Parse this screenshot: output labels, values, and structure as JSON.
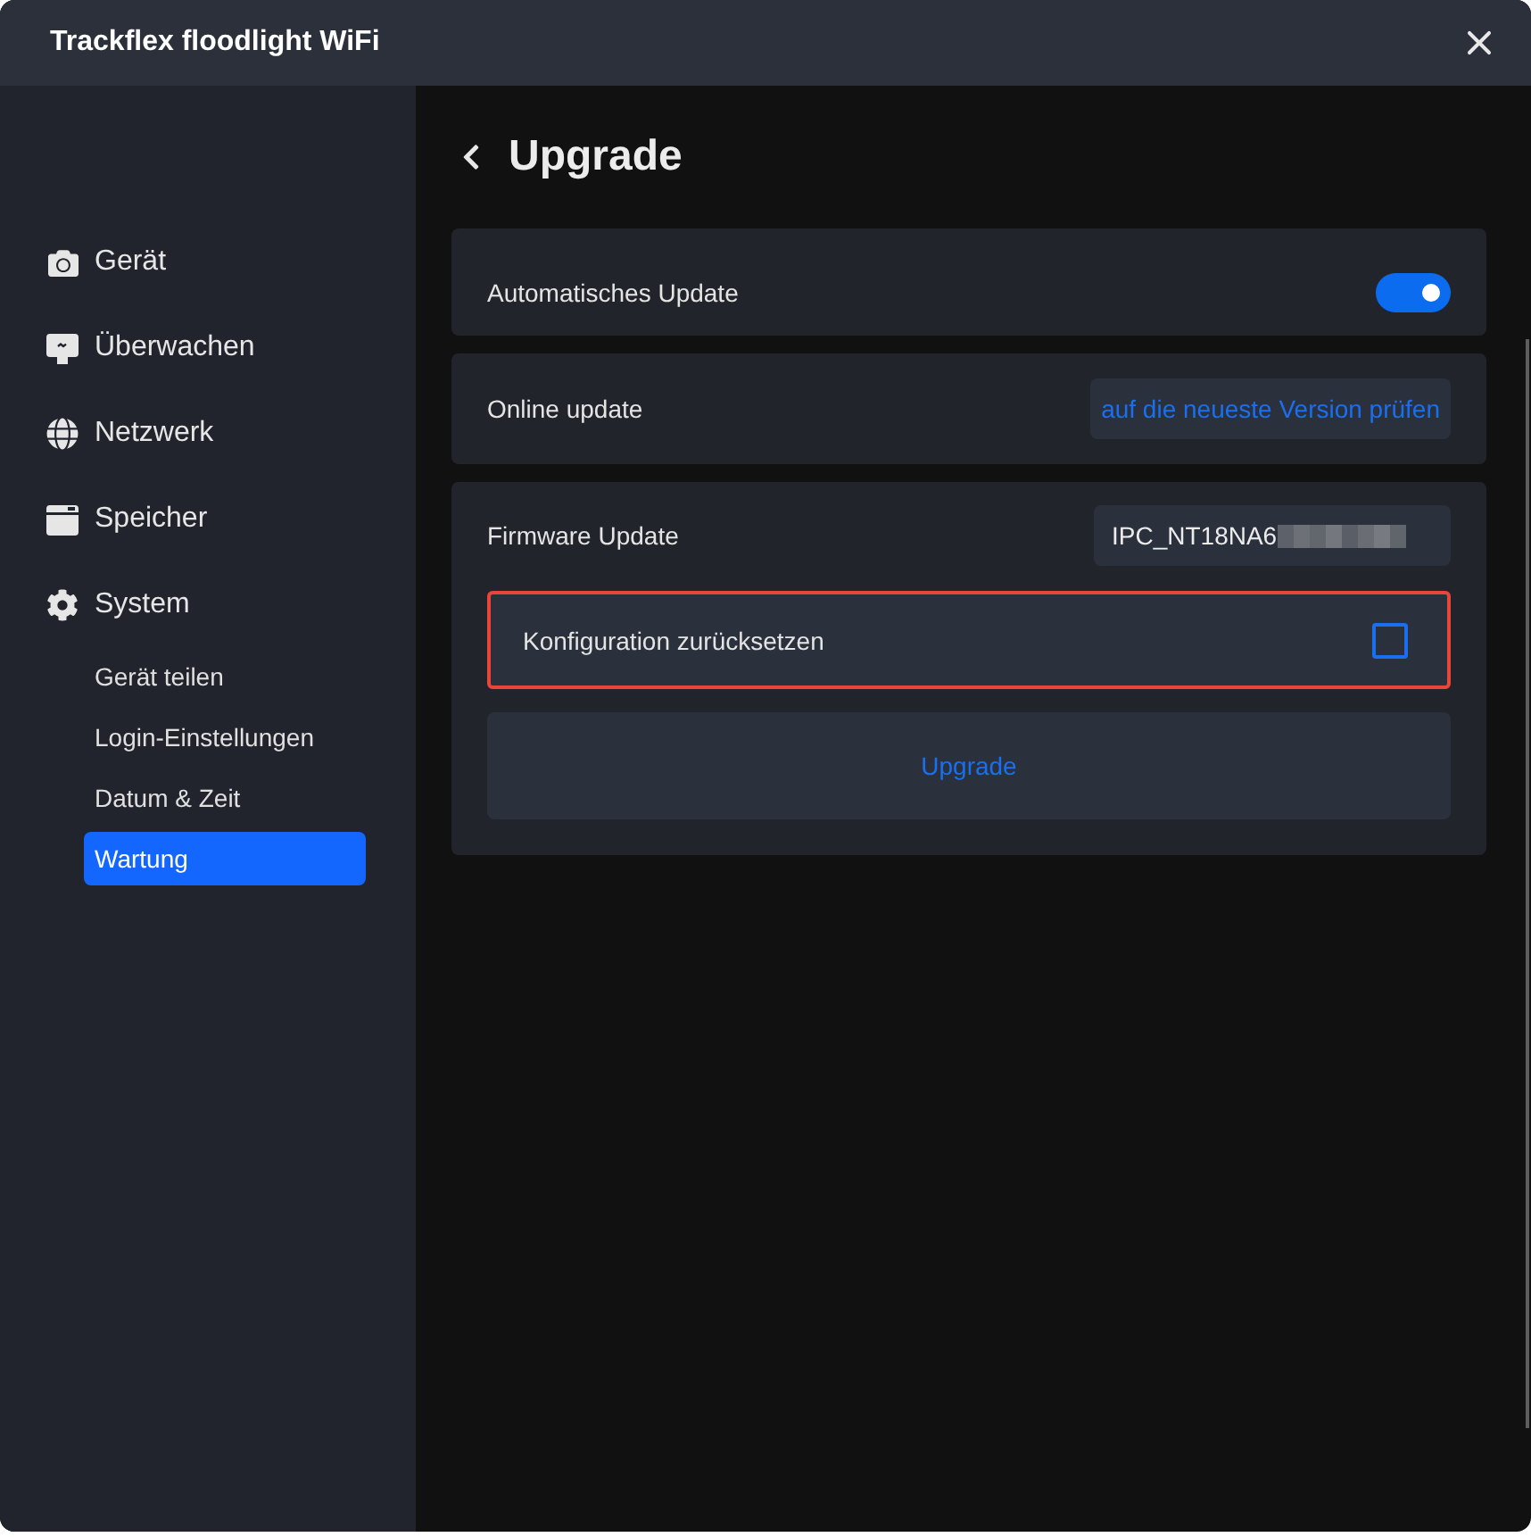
{
  "window": {
    "title": "Trackflex floodlight WiFi"
  },
  "sidebar": {
    "items": [
      {
        "label": "Gerät"
      },
      {
        "label": "Überwachen"
      },
      {
        "label": "Netzwerk"
      },
      {
        "label": "Speicher"
      },
      {
        "label": "System",
        "children": [
          {
            "label": "Gerät teilen",
            "selected": false
          },
          {
            "label": "Login-Einstellungen",
            "selected": false
          },
          {
            "label": "Datum & Zeit",
            "selected": false
          },
          {
            "label": "Wartung",
            "selected": true
          }
        ]
      }
    ]
  },
  "page": {
    "title": "Upgrade"
  },
  "cards": [
    {
      "rows": [
        {
          "kind": "toggle",
          "label": "Automatisches Update",
          "on": true
        }
      ]
    },
    {
      "rows": [
        {
          "kind": "action",
          "label": "Online update",
          "button": "auf die neueste Version prüfen"
        }
      ]
    },
    {
      "rows": [
        {
          "kind": "field",
          "label": "Firmware Update",
          "value": "IPC_NT18NA6",
          "redacted": true
        },
        {
          "kind": "checkbox",
          "label": "Konfiguration zurücksetzen",
          "checked": false,
          "highlighted": true
        },
        {
          "kind": "wide_button",
          "label": "Upgrade"
        }
      ]
    }
  ]
}
